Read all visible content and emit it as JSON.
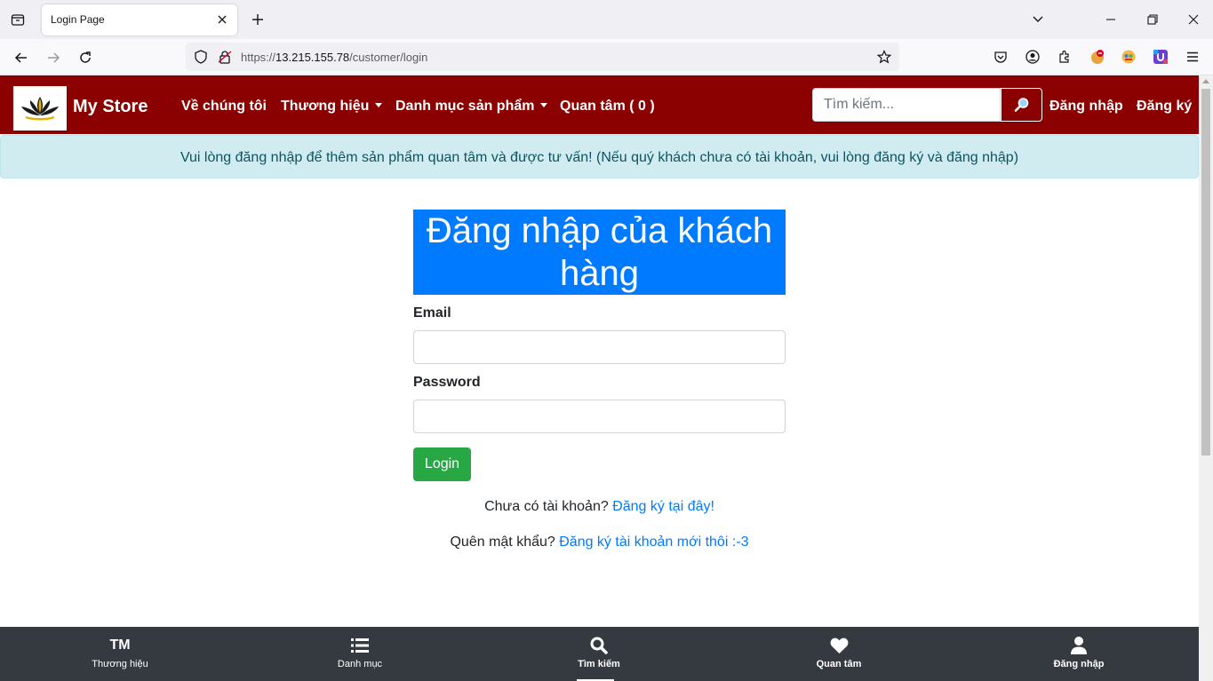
{
  "browser": {
    "tab_title": "Login Page",
    "url_prefix": "https://",
    "url_host": "13.215.155.78",
    "url_path": "/customer/login"
  },
  "site": {
    "brand": "My Store",
    "nav": {
      "about": "Về chúng tôi",
      "brands": "Thương hiệu",
      "categories": "Danh mục sản phẩm",
      "wishlist": "Quan tâm ( 0 )"
    },
    "search_placeholder": "Tìm kiếm...",
    "login_link": "Đăng nhập",
    "register_link": "Đăng ký"
  },
  "alert": {
    "text": "Vui lòng đăng nhập để thêm sản phẩm quan tâm và được tư vấn! (Nếu quý khách chưa có tài khoản, vui lòng đăng ký và đăng nhập)"
  },
  "login": {
    "title": "Đăng nhập của khách hàng",
    "email_label": "Email",
    "email_value": "",
    "password_label": "Password",
    "password_value": "",
    "submit_label": "Login",
    "no_account_text": "Chưa có tài khoản?",
    "no_account_link": "Đăng ký tại đây!",
    "forgot_text": "Quên mật khẩu?",
    "forgot_link": "Đăng ký tài khoản mới thôi :-3"
  },
  "bottom_nav": {
    "brands_icon_text": "TM",
    "brands": "Thương hiệu",
    "categories": "Danh mục",
    "search": "Tìm kiếm",
    "wishlist": "Quan tâm",
    "login": "Đăng nhập"
  },
  "colors": {
    "navbar": "#8b0000",
    "title_bg": "#007bff",
    "login_button": "#28a745",
    "alert_bg": "#d1ecf1",
    "bottom_nav": "#343a40"
  }
}
